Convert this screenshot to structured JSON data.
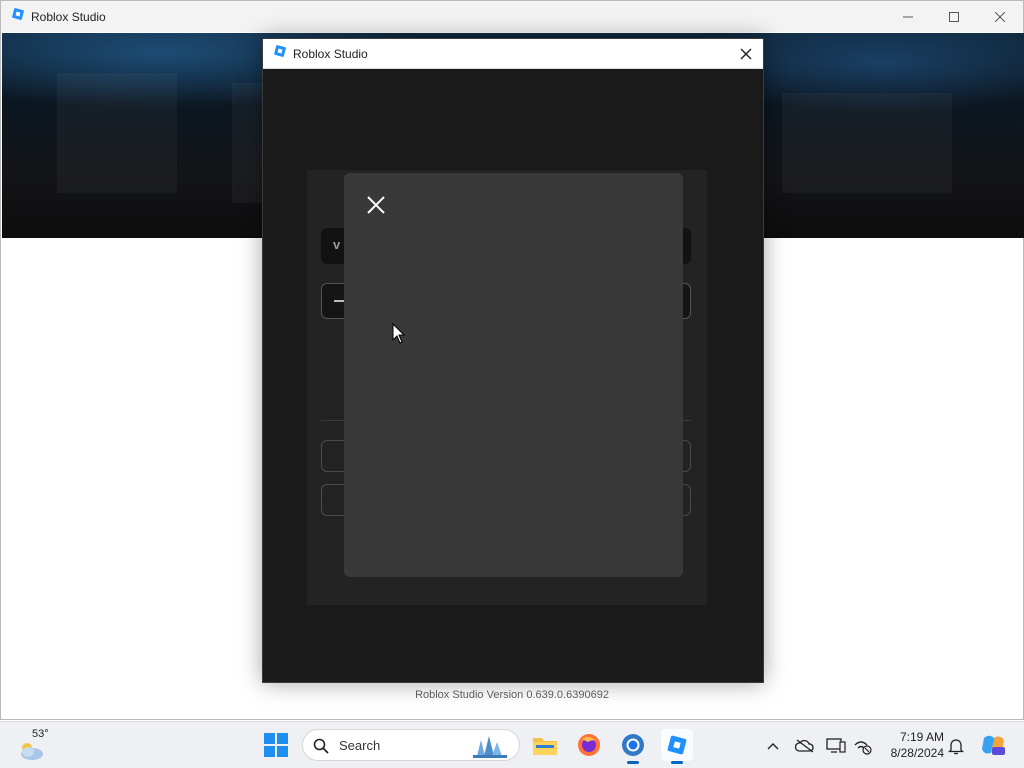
{
  "main_window": {
    "title": "Roblox Studio",
    "controls": [
      "minimize",
      "maximize",
      "close"
    ]
  },
  "dialog": {
    "title": "Roblox Studio",
    "field_stub_text": "v"
  },
  "version_text": "Roblox Studio Version 0.639.0.6390692",
  "taskbar": {
    "weather_temp": "53°",
    "search_label": "Search",
    "apps": [
      "file-explorer",
      "firefox",
      "chrome",
      "roblox-studio"
    ],
    "clock_time": "7:19 AM",
    "clock_date": "8/28/2024"
  },
  "colors": {
    "dialog_bg": "#1a1a1a",
    "overlay_bg": "#393939",
    "roblox_blue": "#1e90ff",
    "taskbar_bg": "#eef0f3"
  }
}
